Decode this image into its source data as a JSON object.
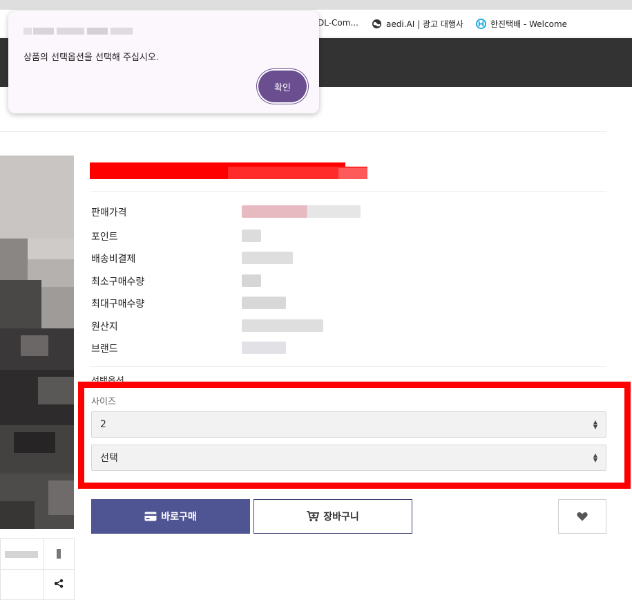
{
  "bookmarks": [
    {
      "label": "DL-Com...",
      "icon": "bookmark-icon"
    },
    {
      "label": "aedi.AI | 광고 대행사",
      "icon": "globe-icon"
    },
    {
      "label": "한진택배 - Welcome",
      "icon": "hanjin-logo-icon"
    }
  ],
  "alert": {
    "message": "상품의 선택옵션을 선택해 주십시오.",
    "confirm_label": "확인"
  },
  "product": {
    "info_labels": [
      "판매가격",
      "포인트",
      "배송비결제",
      "최소구매수량",
      "최대구매수량",
      "원산지",
      "브랜드"
    ],
    "option_heading": "선택옵션",
    "size_label": "사이즈",
    "size_value": "2",
    "second_select_value": "선택"
  },
  "actions": {
    "buy_label": "바로구매",
    "cart_label": "장바구니"
  },
  "colors": {
    "header_bg": "#333333",
    "buy_button": "#4f5492",
    "dialog_button": "#6a4e8f",
    "highlight": "#ff0000"
  }
}
